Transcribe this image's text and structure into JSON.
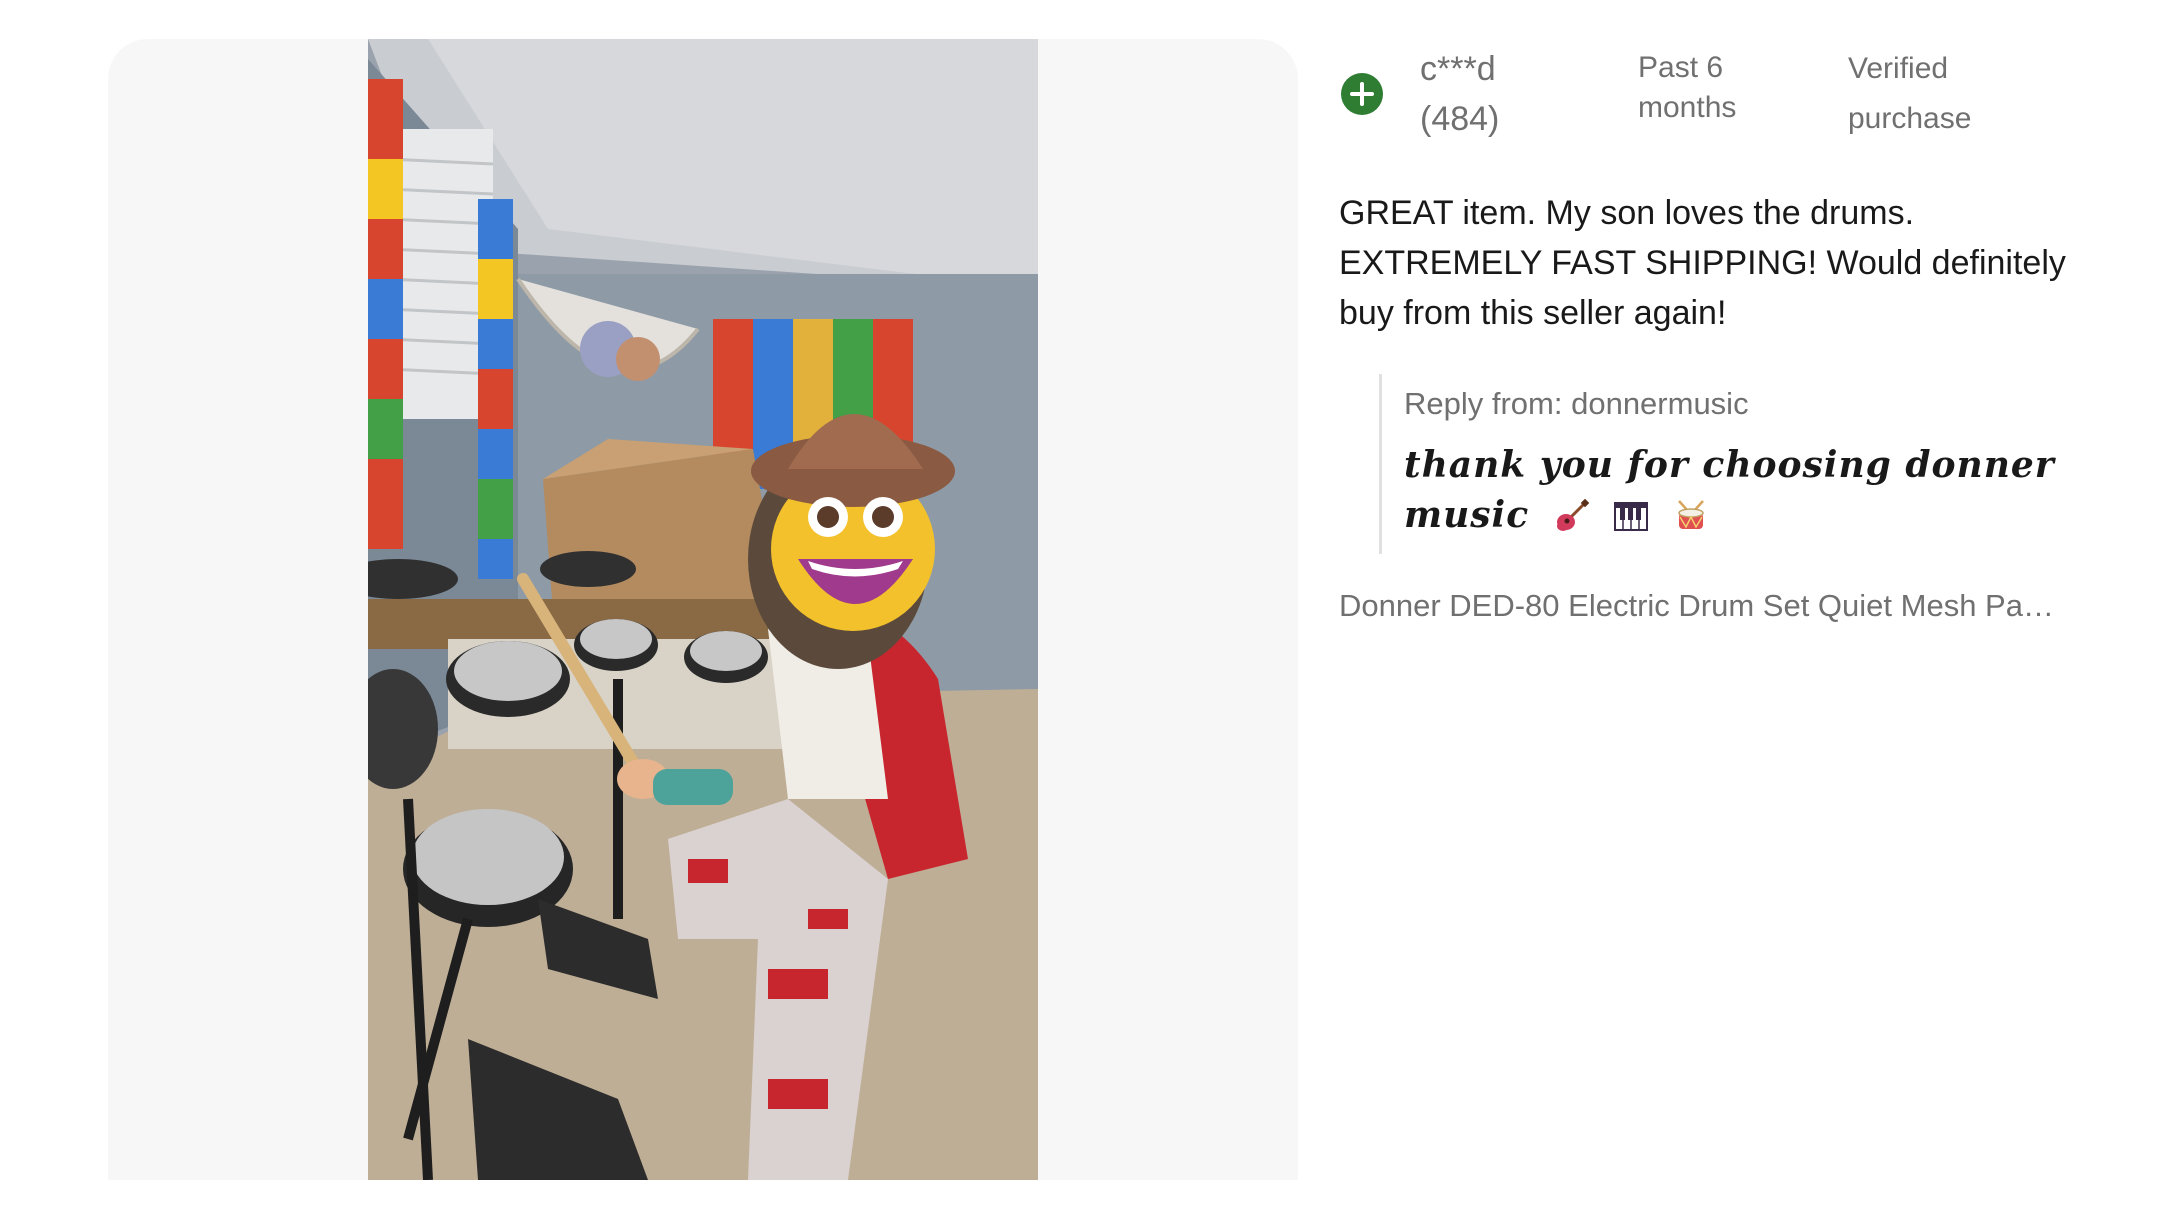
{
  "reviewer": {
    "name": "c***d",
    "feedback_score": "(484)",
    "icon": "plus-circle-icon",
    "icon_color": "#2e7d32"
  },
  "review": {
    "timeframe": "Past 6 months",
    "verified": "Verified purchase",
    "text": "GREAT item. My son loves the drums. EXTREMELY FAST SHIPPING! Would definitely buy from this seller again!"
  },
  "reply": {
    "label": "Reply from: donnermusic",
    "text": "thank you for choosing donner music",
    "emojis": [
      "guitar-icon",
      "piano-keys-icon",
      "drum-icon"
    ]
  },
  "product": {
    "title": "Donner DED-80 Electric Drum Set Quiet Mesh Pad…"
  },
  "photo": {
    "alt": "customer-photo"
  }
}
